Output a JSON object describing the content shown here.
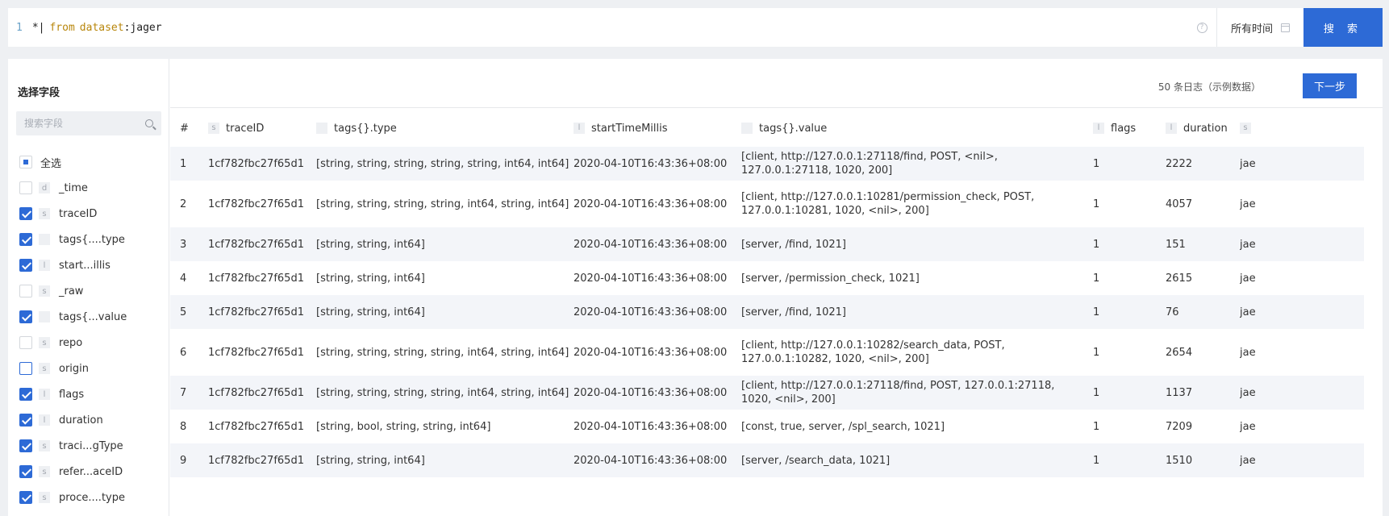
{
  "query": {
    "line_number": "1",
    "pipe": "*|",
    "keyword_from": "from",
    "dataset_word": "dataset",
    "colon": ":",
    "dataset_value": "jager"
  },
  "help_glyph": "?",
  "time_label": "所有时间",
  "search_label": "搜 索",
  "sidebar": {
    "title": "选择字段",
    "search_placeholder": "搜索字段",
    "select_all_label": "全选",
    "fields": [
      {
        "type": "d",
        "name": "_time",
        "checked": false
      },
      {
        "type": "s",
        "name": "traceID",
        "checked": true
      },
      {
        "type": "",
        "name": "tags{....type",
        "checked": true
      },
      {
        "type": "l",
        "name": "start...illis",
        "checked": true
      },
      {
        "type": "s",
        "name": "_raw",
        "checked": false
      },
      {
        "type": "",
        "name": "tags{...value",
        "checked": true
      },
      {
        "type": "s",
        "name": "repo",
        "checked": false
      },
      {
        "type": "s",
        "name": "origin",
        "checked": false
      },
      {
        "type": "l",
        "name": "flags",
        "checked": true
      },
      {
        "type": "l",
        "name": "duration",
        "checked": true
      },
      {
        "type": "s",
        "name": "traci...gType",
        "checked": true
      },
      {
        "type": "s",
        "name": "refer...aceID",
        "checked": true
      },
      {
        "type": "s",
        "name": "proce....type",
        "checked": true
      }
    ]
  },
  "results": {
    "count_text": "50 条日志（示例数据）",
    "next_label": "下一步"
  },
  "table": {
    "columns": [
      {
        "type": "",
        "name": "#"
      },
      {
        "type": "s",
        "name": "traceID"
      },
      {
        "type": "",
        "name": "tags{}.type"
      },
      {
        "type": "l",
        "name": "startTimeMillis"
      },
      {
        "type": "",
        "name": "tags{}.value"
      },
      {
        "type": "l",
        "name": "flags"
      },
      {
        "type": "l",
        "name": "duration"
      },
      {
        "type": "s",
        "name": ""
      }
    ],
    "rows": [
      [
        "1",
        "1cf782fbc27f65d1",
        "[string, string, string, string, string, int64, int64]",
        "2020-04-10T16:43:36+08:00",
        "[client, http://127.0.0.1:27118/find, POST, <nil>, 127.0.0.1:27118, 1020, 200]",
        "1",
        "2222",
        "jae"
      ],
      [
        "2",
        "1cf782fbc27f65d1",
        "[string, string, string, string, int64, string, int64]",
        "2020-04-10T16:43:36+08:00",
        "[client, http://127.0.0.1:10281/permission_check, POST, 127.0.0.1:10281, 1020, <nil>, 200]",
        "1",
        "4057",
        "jae"
      ],
      [
        "3",
        "1cf782fbc27f65d1",
        "[string, string, int64]",
        "2020-04-10T16:43:36+08:00",
        "[server, /find, 1021]",
        "1",
        "151",
        "jae"
      ],
      [
        "4",
        "1cf782fbc27f65d1",
        "[string, string, int64]",
        "2020-04-10T16:43:36+08:00",
        "[server, /permission_check, 1021]",
        "1",
        "2615",
        "jae"
      ],
      [
        "5",
        "1cf782fbc27f65d1",
        "[string, string, int64]",
        "2020-04-10T16:43:36+08:00",
        "[server, /find, 1021]",
        "1",
        "76",
        "jae"
      ],
      [
        "6",
        "1cf782fbc27f65d1",
        "[string, string, string, string, int64, string, int64]",
        "2020-04-10T16:43:36+08:00",
        "[client, http://127.0.0.1:10282/search_data, POST, 127.0.0.1:10282, 1020, <nil>, 200]",
        "1",
        "2654",
        "jae"
      ],
      [
        "7",
        "1cf782fbc27f65d1",
        "[string, string, string, string, int64, string, int64]",
        "2020-04-10T16:43:36+08:00",
        "[client, http://127.0.0.1:27118/find, POST, 127.0.0.1:27118, 1020, <nil>, 200]",
        "1",
        "1137",
        "jae"
      ],
      [
        "8",
        "1cf782fbc27f65d1",
        "[string, bool, string, string, int64]",
        "2020-04-10T16:43:36+08:00",
        "[const, true, server, /spl_search, 1021]",
        "1",
        "7209",
        "jae"
      ],
      [
        "9",
        "1cf782fbc27f65d1",
        "[string, string, int64]",
        "2020-04-10T16:43:36+08:00",
        "[server, /search_data, 1021]",
        "1",
        "1510",
        "jae"
      ]
    ]
  },
  "colors": {
    "accent": "#2d6ad6",
    "page_bg": "#eef0f3",
    "stripe": "#f3f5f9",
    "keyword": "#b8860b"
  }
}
